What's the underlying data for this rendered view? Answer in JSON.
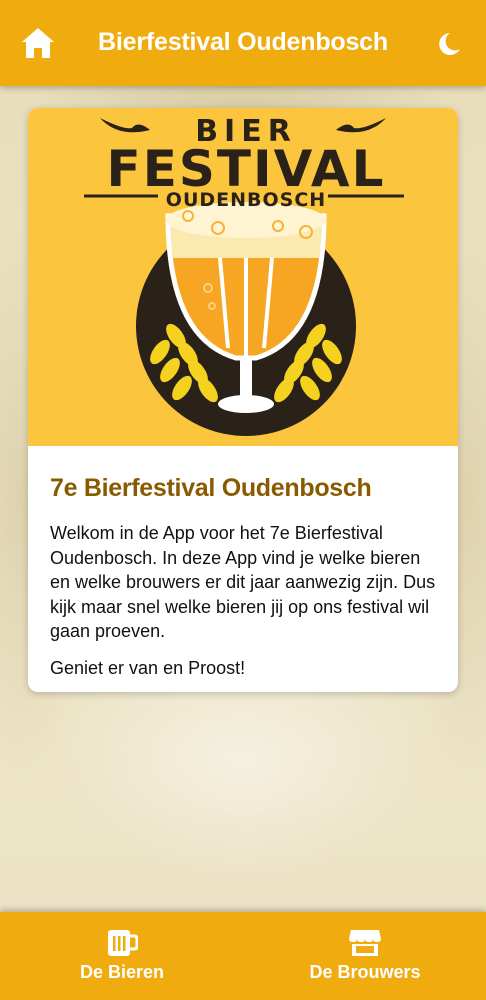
{
  "header": {
    "title": "Bierfestival Oudenbosch",
    "home_icon": "home-icon",
    "theme_icon": "moon-icon"
  },
  "logo": {
    "line1": "BIER",
    "line2": "FESTIVAL",
    "line3": "OUDENBOSCH"
  },
  "card": {
    "title": "7e Bierfestival Oudenbosch",
    "paragraph1": "Welkom in de App voor het 7e Bierfestival Oudenbosch. In deze App vind je welke bieren en welke brouwers er dit jaar aanwezig zijn. Dus kijk maar snel welke bieren jij op ons festival wil gaan proeven.",
    "paragraph2": "Geniet er van en Proost!"
  },
  "bottom_nav": {
    "tabs": [
      {
        "label": "De Bieren",
        "icon": "beer-mug-icon"
      },
      {
        "label": "De Brouwers",
        "icon": "store-icon"
      }
    ]
  },
  "colors": {
    "brand": "#f0ac0f",
    "title_brown": "#8a5a00",
    "logo_bg": "#fbc63e"
  }
}
